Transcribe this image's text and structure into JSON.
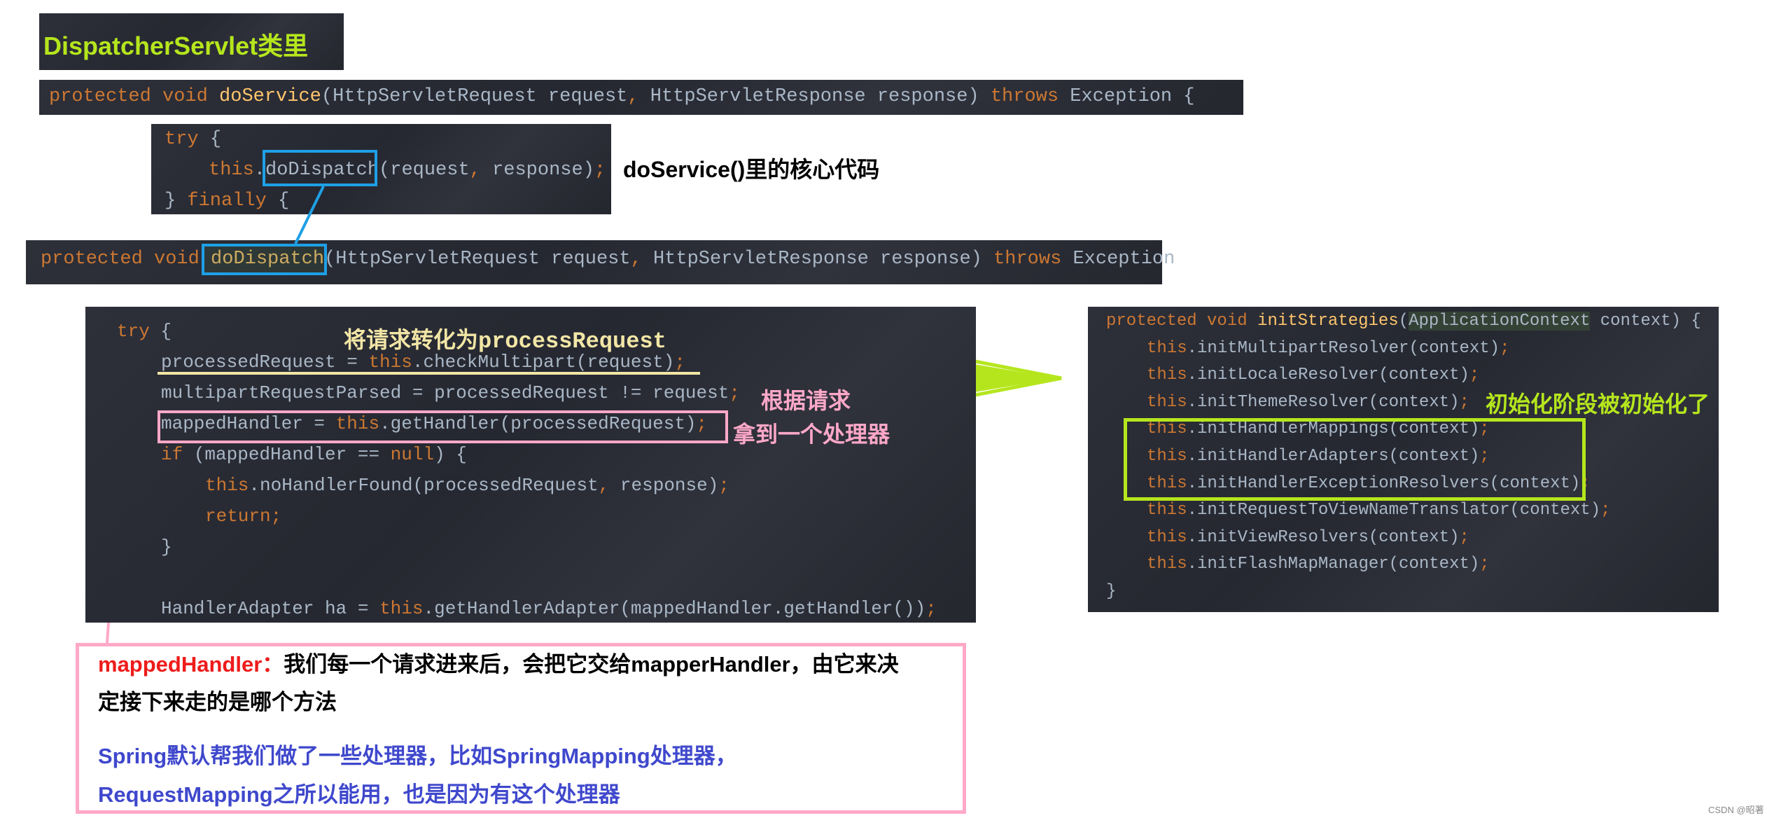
{
  "title": "DispatcherServlet类里",
  "annotations": {
    "doservice_core": "doService()里的核心代码",
    "to_process_request": "将请求转化为processRequest",
    "by_request_line1": "根据请求",
    "by_request_line2": "拿到一个处理器",
    "init_stage": "初始化阶段被初始化了"
  },
  "note": {
    "label": "mappedHandler：",
    "line1": "我们每一个请求进来后，会把它交给mapperHandler，由它来决",
    "line2": "定接下来走的是哪个方法",
    "line3": "Spring默认帮我们做了一些处理器，比如SpringMapping处理器，",
    "line4": "RequestMapping之所以能用，也是因为有这个处理器"
  },
  "watermark": "CSDN @昭著",
  "colors": {
    "keyword": "#cc7832",
    "method": "#ffc66d",
    "identifier": "#a9b7c6",
    "highlight_green": "#b5e61d",
    "connector_blue": "#1ea0e6",
    "pink": "#ffa8c8",
    "cream": "#f2e6a6",
    "note_red": "#ee1b1b",
    "note_blue": "#3f48cc"
  },
  "code_blocks": {
    "doservice_sig": [
      {
        "indent": 0,
        "tokens": [
          {
            "t": "protected void ",
            "k": "kw"
          },
          {
            "t": "doService",
            "k": "fn"
          },
          {
            "t": "(HttpServletRequest request",
            "k": "id"
          },
          {
            "t": ", ",
            "k": "kw"
          },
          {
            "t": "HttpServletResponse response) ",
            "k": "id"
          },
          {
            "t": "throws ",
            "k": "kw"
          },
          {
            "t": "Exception {",
            "k": "id"
          }
        ]
      }
    ],
    "try_block": [
      {
        "indent": 0,
        "tokens": [
          {
            "t": "try ",
            "k": "kw"
          },
          {
            "t": "{",
            "k": "id"
          }
        ]
      },
      {
        "indent": 1,
        "tokens": [
          {
            "t": "this",
            "k": "kw"
          },
          {
            "t": ".doDispatch(request",
            "k": "id"
          },
          {
            "t": ", ",
            "k": "kw"
          },
          {
            "t": "response)",
            "k": "id"
          },
          {
            "t": ";",
            "k": "kw"
          }
        ]
      },
      {
        "indent": 0,
        "tokens": [
          {
            "t": "} ",
            "k": "id"
          },
          {
            "t": "finally ",
            "k": "kw"
          },
          {
            "t": "{",
            "k": "id"
          }
        ]
      }
    ],
    "dodispatch_sig": [
      {
        "indent": 0,
        "tokens": [
          {
            "t": "protected void ",
            "k": "kw"
          },
          {
            "t": "doDispatch",
            "k": "fn"
          },
          {
            "t": "(HttpServletRequest request",
            "k": "id"
          },
          {
            "t": ", ",
            "k": "kw"
          },
          {
            "t": "HttpServletResponse response) ",
            "k": "id"
          },
          {
            "t": "throws ",
            "k": "kw"
          },
          {
            "t": "Exception",
            "k": "id"
          }
        ]
      }
    ],
    "dispatch_body": [
      {
        "indent": 0,
        "tokens": [
          {
            "t": "try ",
            "k": "kw"
          },
          {
            "t": "{",
            "k": "id"
          }
        ]
      },
      {
        "indent": 1,
        "tokens": [
          {
            "t": "processedRequest = ",
            "k": "id"
          },
          {
            "t": "this",
            "k": "kw"
          },
          {
            "t": ".checkMultipart(request)",
            "k": "id"
          },
          {
            "t": ";",
            "k": "kw"
          }
        ]
      },
      {
        "indent": 1,
        "tokens": [
          {
            "t": "multipartRequestParsed = processedRequest != request",
            "k": "id"
          },
          {
            "t": ";",
            "k": "kw"
          }
        ]
      },
      {
        "indent": 1,
        "tokens": [
          {
            "t": "mappedHandler = ",
            "k": "id"
          },
          {
            "t": "this",
            "k": "kw"
          },
          {
            "t": ".getHandler(processedRequest)",
            "k": "id"
          },
          {
            "t": ";",
            "k": "kw"
          }
        ]
      },
      {
        "indent": 1,
        "tokens": [
          {
            "t": "if ",
            "k": "kw"
          },
          {
            "t": "(mappedHandler == ",
            "k": "id"
          },
          {
            "t": "null",
            "k": "kw"
          },
          {
            "t": ") {",
            "k": "id"
          }
        ]
      },
      {
        "indent": 2,
        "tokens": [
          {
            "t": "this",
            "k": "kw"
          },
          {
            "t": ".noHandlerFound(processedRequest",
            "k": "id"
          },
          {
            "t": ", ",
            "k": "kw"
          },
          {
            "t": "response)",
            "k": "id"
          },
          {
            "t": ";",
            "k": "kw"
          }
        ]
      },
      {
        "indent": 2,
        "tokens": [
          {
            "t": "return;",
            "k": "kw"
          }
        ]
      },
      {
        "indent": 1,
        "tokens": [
          {
            "t": "}",
            "k": "id"
          }
        ]
      },
      {
        "indent": 0,
        "tokens": []
      },
      {
        "indent": 1,
        "tokens": [
          {
            "t": "HandlerAdapter ha = ",
            "k": "id"
          },
          {
            "t": "this",
            "k": "kw"
          },
          {
            "t": ".getHandlerAdapter(mappedHandler.getHandler())",
            "k": "id"
          },
          {
            "t": ";",
            "k": "kw"
          }
        ]
      }
    ],
    "init_strategies": [
      {
        "indent": 0,
        "tokens": [
          {
            "t": "protected void ",
            "k": "kw"
          },
          {
            "t": "initStrategies",
            "k": "fn"
          },
          {
            "t": "(",
            "k": "id"
          },
          {
            "t": "ApplicationContext",
            "k": "hl"
          },
          {
            "t": " context) {",
            "k": "id"
          }
        ]
      },
      {
        "indent": 1,
        "tokens": [
          {
            "t": "this",
            "k": "kw"
          },
          {
            "t": ".initMultipartResolver(context)",
            "k": "id"
          },
          {
            "t": ";",
            "k": "kw"
          }
        ]
      },
      {
        "indent": 1,
        "tokens": [
          {
            "t": "this",
            "k": "kw"
          },
          {
            "t": ".initLocaleResolver(context)",
            "k": "id"
          },
          {
            "t": ";",
            "k": "kw"
          }
        ]
      },
      {
        "indent": 1,
        "tokens": [
          {
            "t": "this",
            "k": "kw"
          },
          {
            "t": ".initThemeResolver(context)",
            "k": "id"
          },
          {
            "t": ";",
            "k": "kw"
          }
        ]
      },
      {
        "indent": 1,
        "tokens": [
          {
            "t": "this",
            "k": "kw"
          },
          {
            "t": ".initHandlerMappings(context)",
            "k": "id"
          },
          {
            "t": ";",
            "k": "kw"
          }
        ]
      },
      {
        "indent": 1,
        "tokens": [
          {
            "t": "this",
            "k": "kw"
          },
          {
            "t": ".initHandlerAdapters(context)",
            "k": "id"
          },
          {
            "t": ";",
            "k": "kw"
          }
        ]
      },
      {
        "indent": 1,
        "tokens": [
          {
            "t": "this",
            "k": "kw"
          },
          {
            "t": ".initHandlerExceptionResolvers(context)",
            "k": "id"
          },
          {
            "t": ";",
            "k": "kw"
          }
        ]
      },
      {
        "indent": 1,
        "tokens": [
          {
            "t": "this",
            "k": "kw"
          },
          {
            "t": ".initRequestToViewNameTranslator(context)",
            "k": "id"
          },
          {
            "t": ";",
            "k": "kw"
          }
        ]
      },
      {
        "indent": 1,
        "tokens": [
          {
            "t": "this",
            "k": "kw"
          },
          {
            "t": ".initViewResolvers(context)",
            "k": "id"
          },
          {
            "t": ";",
            "k": "kw"
          }
        ]
      },
      {
        "indent": 1,
        "tokens": [
          {
            "t": "this",
            "k": "kw"
          },
          {
            "t": ".initFlashMapManager(context)",
            "k": "id"
          },
          {
            "t": ";",
            "k": "kw"
          }
        ]
      },
      {
        "indent": 0,
        "tokens": [
          {
            "t": "}",
            "k": "id"
          }
        ]
      }
    ]
  }
}
